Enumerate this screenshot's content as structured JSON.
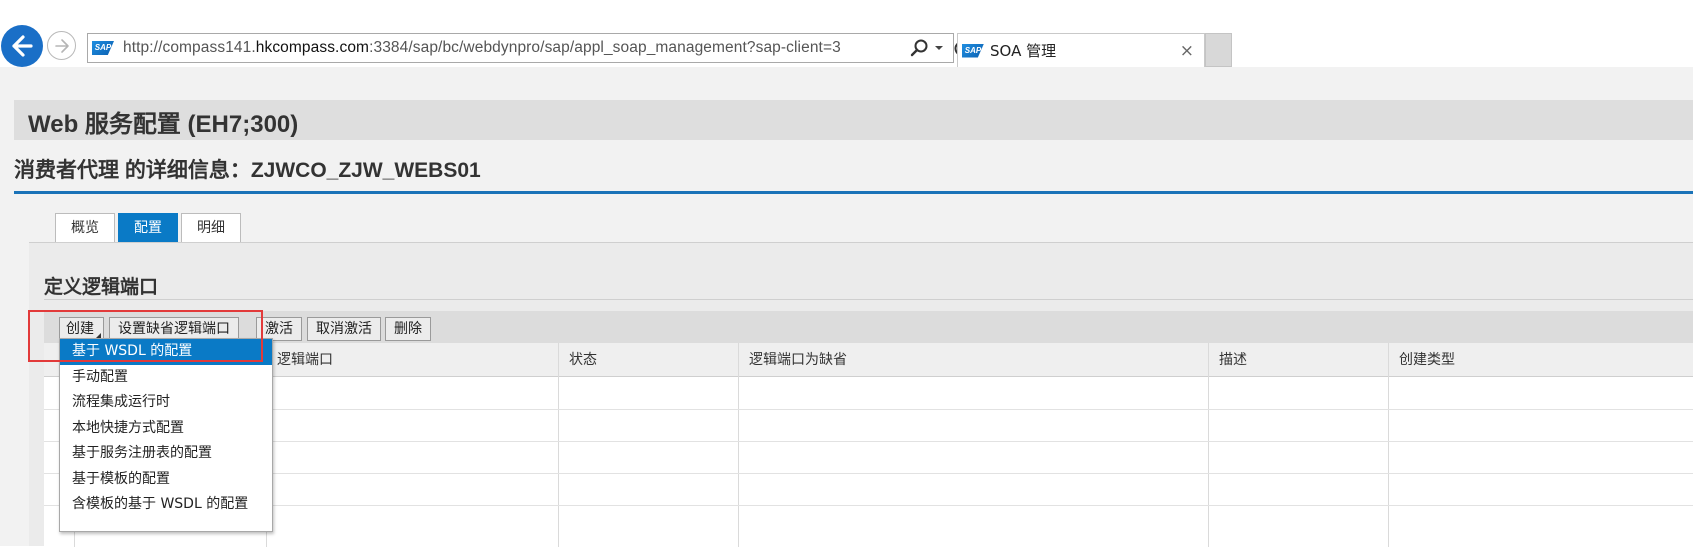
{
  "browser": {
    "url_prefix": "http://compass141.",
    "url_domain": "hkcompass.com",
    "url_rest": ":3384/sap/bc/webdynpro/sap/appl_soap_management?sap-client=3",
    "tab_title": "SOA 管理",
    "tab_close": "×",
    "logo_text": "SAP"
  },
  "page": {
    "title": "Web 服务配置 (EH7;300)",
    "detail_title": "消费者代理 的详细信息：ZJWCO_ZJW_WEBS01"
  },
  "tabs": [
    {
      "label": "概览"
    },
    {
      "label": "配置"
    },
    {
      "label": "明细"
    }
  ],
  "section": {
    "title": "定义逻辑端口"
  },
  "toolbar": {
    "create": "创建",
    "set_default": "设置缺省逻辑端口",
    "activate": "激活",
    "deactivate": "取消激活",
    "delete": "删除"
  },
  "table": {
    "columns": [
      "逻辑端口",
      "状态",
      "逻辑端口为缺省",
      "描述",
      "创建类型"
    ]
  },
  "create_menu": {
    "items": [
      "基于 WSDL 的配置",
      "手动配置",
      "流程集成运行时",
      "本地快捷方式配置",
      "基于服务注册表的配置",
      "基于模板的配置",
      "含模板的基于 WSDL 的配置"
    ],
    "selected_index": 0
  },
  "colors": {
    "sap_blue": "#0a7ac6",
    "back_button": "#1a6fc7",
    "highlight": "#e23a3a",
    "title_underline": "#1b73b8"
  }
}
